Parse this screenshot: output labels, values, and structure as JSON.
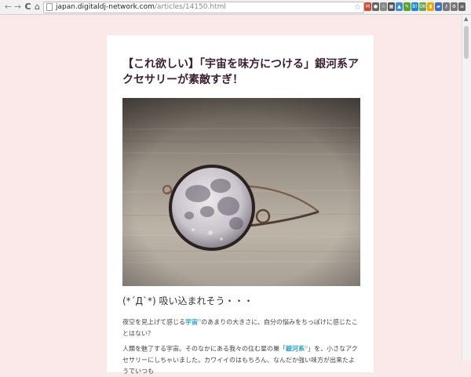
{
  "browser": {
    "url_host": "japan.digitaldj-network.com",
    "url_path": "/articles/14150.html",
    "nav": {
      "back": "←",
      "forward": "→",
      "reload": "C",
      "home": "⌂"
    },
    "extensions": [
      {
        "icon": "gmail-icon",
        "label": "M",
        "color": "#d14836"
      },
      {
        "icon": "record-icon",
        "label": "●",
        "color": "#666666"
      },
      {
        "icon": "star-icon",
        "label": "☆",
        "color": "#888888"
      },
      {
        "icon": "apps-icon",
        "label": "▦",
        "color": "#555555"
      },
      {
        "icon": "photo-icon",
        "label": "▲",
        "color": "#3c8ed6"
      },
      {
        "icon": "evernote-icon",
        "label": "✎",
        "color": "#5ba525"
      },
      {
        "icon": "bookmark-icon",
        "label": "B!",
        "color": "#1d8ad6"
      },
      {
        "icon": "ok-icon",
        "label": "OK",
        "color": "#6aa84f"
      },
      {
        "icon": "bar-icon",
        "label": "▮",
        "color": "#f1a800"
      },
      {
        "icon": "chat-icon",
        "label": "▰",
        "color": "#3b6fd6"
      },
      {
        "icon": "key-icon",
        "label": "⚷",
        "color": "#777777"
      },
      {
        "icon": "settings-icon",
        "label": "⚙",
        "color": "#777777"
      },
      {
        "icon": "menu-icon",
        "label": "≡",
        "color": "#666666"
      }
    ]
  },
  "article": {
    "title": "【これ欲しい】「宇宙を味方につける」銀河系アクセサリーが素敵すぎ！",
    "subhead": "(*´Д`*) 吸い込まれそう・・・",
    "p1": {
      "before": "夜空を見上げて感じる",
      "keyword": "宇宙",
      "after": "のあまりの大きさに、自分の悩みをちっぽけに感じたことはない？"
    },
    "p2": {
      "before": "人類を魅了する宇宙。そのなかにある我々の住む星の巣「",
      "keyword": "銀河系",
      "after": "」を、小さなアクセサリーにしちゃいました。カワイイのはもちろん、なんだか強い味方が出来たようでいつも"
    }
  },
  "colors": {
    "page_bg": "#fbe9ea",
    "title": "#3d1f33",
    "keyword": "#2aa3c7"
  }
}
